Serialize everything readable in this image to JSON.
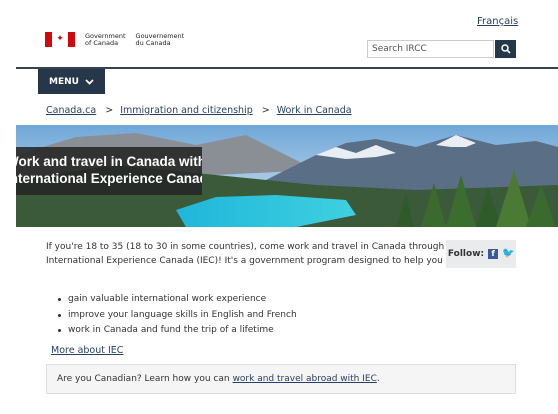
{
  "header": {
    "language_toggle": "Français",
    "signature": {
      "en_line1": "Government",
      "en_line2": "of Canada",
      "fr_line1": "Gouvernement",
      "fr_line2": "du Canada"
    },
    "search": {
      "placeholder": "Search IRCC"
    }
  },
  "nav": {
    "menu_label": "MENU"
  },
  "breadcrumb": {
    "items": [
      "Canada.ca",
      "Immigration and citizenship",
      "Work in Canada"
    ],
    "separator": ">"
  },
  "hero": {
    "line1": "Work and travel in Canada with",
    "line2": "International Experience Canada"
  },
  "intro": {
    "text": "If you're 18 to 35 (18 to 30 in some countries), come work and travel in Canada through International Experience Canada (IEC)! It's a government program designed to help you"
  },
  "benefits": [
    "gain valuable international work experience",
    "improve your language skills in English and French",
    "work in Canada and fund the trip of a lifetime"
  ],
  "social": {
    "follow_label": "Follow:",
    "facebook_glyph": "f",
    "twitter_glyph": "🐦"
  },
  "more_link": "More about IEC",
  "canadian_box": {
    "prefix": "Are you Canadian? Learn how you can",
    "link": "work and travel abroad with IEC",
    "suffix": "."
  },
  "colors": {
    "gc_red": "#d3080c",
    "nav_dark": "#26374a",
    "link": "#284162",
    "facebook": "#3b5998",
    "twitter": "#55acee"
  }
}
